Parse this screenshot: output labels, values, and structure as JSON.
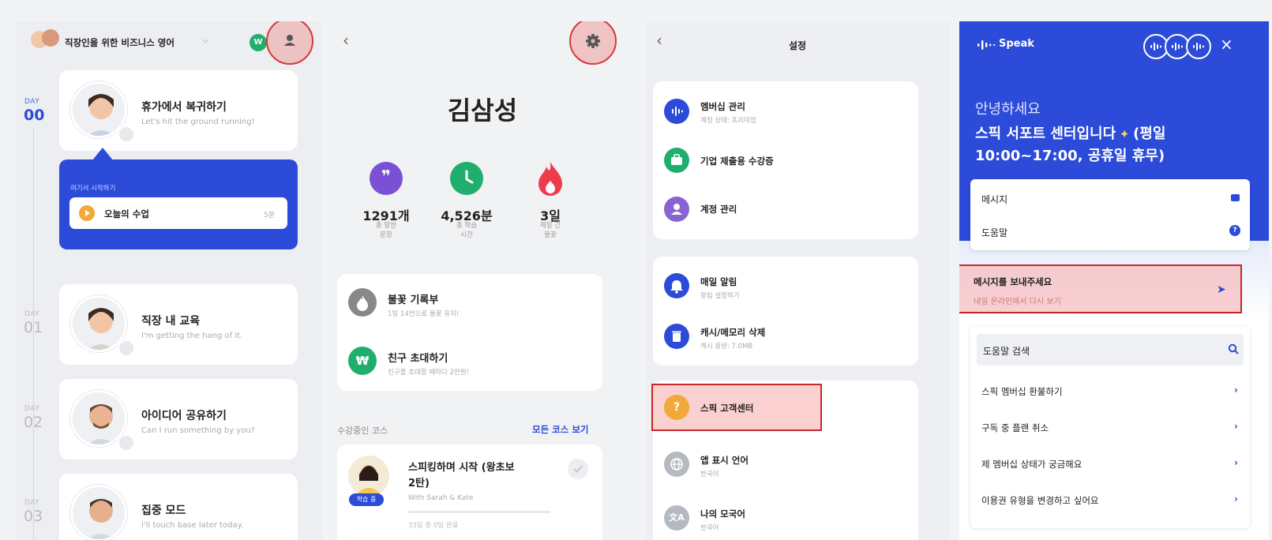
{
  "panel1": {
    "header_title": "직장인을 위한 비즈니스 영어",
    "badge_letter": "W",
    "lessons": [
      {
        "day_label": "DAY",
        "day_num": "00",
        "title": "휴가에서 복귀하기",
        "subtitle": "Let's hit the ground running!"
      },
      {
        "day_label": "DAY",
        "day_num": "01",
        "title": "직장 내 교육",
        "subtitle": "I'm getting the hang of it."
      },
      {
        "day_label": "DAY",
        "day_num": "02",
        "title": "아이디어 공유하기",
        "subtitle": "Can I run something by you?"
      },
      {
        "day_label": "DAY",
        "day_num": "03",
        "title": "집중 모드",
        "subtitle": "I'll touch base later today."
      }
    ],
    "start_here": "여기서 시작하기",
    "today_lesson": "오늘의 수업",
    "today_duration": "5분"
  },
  "panel2": {
    "user_name": "김삼성",
    "stats": [
      {
        "value": "1291개",
        "label_line1": "총 말한",
        "label_line2": "문장",
        "color": "#7b4fd6"
      },
      {
        "value": "4,526분",
        "label_line1": "총 학습",
        "label_line2": "시간",
        "color": "#1fae6e"
      },
      {
        "value": "3일",
        "label_line1": "제일 긴",
        "label_line2": "불꽃",
        "color": "#ee3b4c"
      }
    ],
    "menu": [
      {
        "title": "불꽃 기록부",
        "subtitle": "1일 14언으로 불꽃 유지!"
      },
      {
        "title": "친구 초대하기",
        "subtitle": "친구를 초대할 때마다 2만원!"
      }
    ],
    "courses_label": "수강중인 코스",
    "all_courses": "모든 코스 보기",
    "course": {
      "title_line1": "스피킹하며 시작 (왕초보",
      "title_line2": "2탄)",
      "instructor": "With Sarah & Kate",
      "badge": "학습 중",
      "progress_text": "33일 중 0일 완료"
    }
  },
  "panel3": {
    "title": "설정",
    "group1": [
      {
        "title": "멤버십 관리",
        "subtitle": "계정 상태: 프리미엄",
        "color": "#2b4bd8"
      },
      {
        "title": "기업 제출용 수강증",
        "subtitle": "",
        "color": "#1fae6e"
      },
      {
        "title": "계정 관리",
        "subtitle": "",
        "color": "#8a63d2"
      }
    ],
    "group2": [
      {
        "title": "매일 알림",
        "subtitle": "알림 설정하기",
        "color": "#2b4bd8"
      },
      {
        "title": "캐시/메모리 삭제",
        "subtitle": "캐시 용량: 7.0MB",
        "color": "#2b4bd8"
      }
    ],
    "group3": [
      {
        "title": "스픽 고객센터",
        "subtitle": "",
        "color": "#f2a93b"
      },
      {
        "title": "앱 표시 언어",
        "subtitle": "한국어",
        "color": "#b5b9c0"
      },
      {
        "title": "나의 모국어",
        "subtitle": "한국어",
        "color": "#b5b9c0"
      }
    ]
  },
  "panel4": {
    "brand": "Speak",
    "greeting": "안녕하세요",
    "headline_line1": "스픽 서포트 센터입니다",
    "headline_line1b": "(평일",
    "headline_line2": "10:00~17:00, 공휴일 휴무)",
    "menu": [
      {
        "label": "메시지"
      },
      {
        "label": "도움말"
      }
    ],
    "send_message": "메시지를 보내주세요",
    "send_sub": "내일 온라인에서 다시 보기",
    "help_search": "도움말 검색",
    "help_items": [
      "스픽 멤버십 환불하기",
      "구독 중 플랜 취소",
      "제 멤버십 상태가 궁금해요",
      "이용권 유형을 변경하고 싶어요"
    ],
    "accent": "#2b4bd8"
  }
}
